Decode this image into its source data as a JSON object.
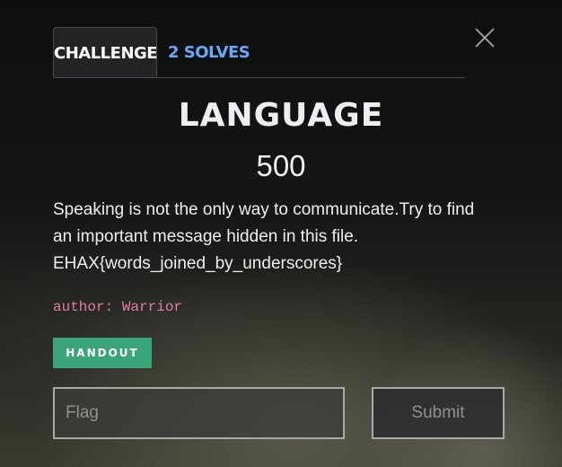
{
  "modal": {
    "tabs": [
      {
        "label": "CHALLENGE",
        "active": true
      },
      {
        "label": "2 SOLVES",
        "active": false
      }
    ],
    "close_icon": "close-icon"
  },
  "challenge": {
    "name": "LANGUAGE",
    "value": "500",
    "description_lines": [
      "Speaking is not the only way to communicate.Try to find",
      "an important message hidden in this file.",
      "EHAX{words_joined_by_underscores}"
    ],
    "author": "author: Warrior",
    "handout_label": "HANDOUT"
  },
  "submission": {
    "flag_value": "",
    "flag_placeholder": "Flag",
    "submit_label": "Submit"
  },
  "colors": {
    "handout_green": "#3aa47a",
    "solves_blue": "#6aa7f5",
    "author_pink": "#e779a8"
  }
}
